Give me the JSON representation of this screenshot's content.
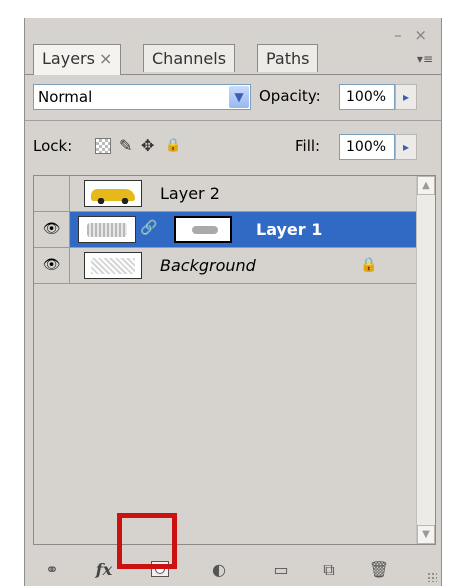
{
  "window": {
    "controls": "– ×"
  },
  "tabs": [
    {
      "label": "Layers",
      "close": "×",
      "active": true
    },
    {
      "label": "Channels",
      "active": false
    },
    {
      "label": "Paths",
      "active": false
    }
  ],
  "panel_menu_icon": "▾≡",
  "blend_mode": {
    "value": "Normal",
    "arrow": "▼"
  },
  "opacity": {
    "label": "Opacity:",
    "value": "100%",
    "arrow": "▸"
  },
  "lock": {
    "label": "Lock:",
    "icons": [
      "lock-transparent-icon",
      "lock-image-icon",
      "lock-position-icon",
      "lock-all-icon"
    ],
    "brush": "✎",
    "move": "✥",
    "all": "🔒"
  },
  "fill": {
    "label": "Fill:",
    "value": "100%",
    "arrow": "▸"
  },
  "layers": [
    {
      "name": "Layer 2",
      "visible": false,
      "selected": false,
      "thumbnail": "car"
    },
    {
      "name": "Layer 1",
      "visible": true,
      "selected": true,
      "thumbnail": "sketch",
      "has_mask": true,
      "chain": "🔗"
    },
    {
      "name": "Background",
      "visible": true,
      "selected": false,
      "thumbnail": "background",
      "locked": true,
      "lock_glyph": "🔒"
    }
  ],
  "eye_glyph": "👁",
  "scrollbar": {
    "up": "▲",
    "down": "▼"
  },
  "toolbar": {
    "link": "⚭",
    "fx": "fx",
    "adjust": "◐",
    "group": "▭",
    "new_layer": "⧉",
    "delete": "🗑"
  },
  "colors": {
    "panel_bg": "#d6d3ce",
    "selection": "#316ac5",
    "highlight": "#cc1111",
    "field_border": "#7b9ebd"
  }
}
